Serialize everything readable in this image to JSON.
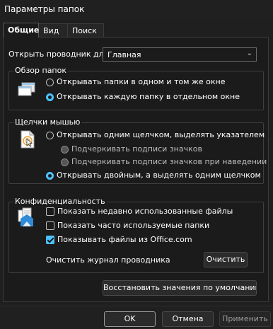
{
  "window": {
    "title": "Параметры папок"
  },
  "tabs": [
    {
      "label": "Общие",
      "active": true
    },
    {
      "label": "Вид",
      "active": false
    },
    {
      "label": "Поиск",
      "active": false
    }
  ],
  "open_explorer": {
    "label": "Открыть проводник для:",
    "value": "Главная"
  },
  "browse": {
    "title": "Обзор папок",
    "options": [
      {
        "label": "Открывать папки в одном и том же окне",
        "selected": false
      },
      {
        "label": "Открывать каждую папку в отдельном окне",
        "selected": true
      }
    ]
  },
  "clicks": {
    "title": "Щелчки мышью",
    "single_click": {
      "label": "Открывать одним щелчком, выделять указателем",
      "selected": false
    },
    "underline_always": {
      "label": "Подчеркивать подписи значков",
      "selected": false
    },
    "underline_hover": {
      "label": "Подчеркивать подписи значков при наведении",
      "selected": false
    },
    "double_click": {
      "label": "Открывать двойным, а выделять одним щелчком",
      "selected": true
    }
  },
  "privacy": {
    "title": "Конфиденциальность",
    "recent_files": {
      "label": "Показать недавно использованные файлы",
      "checked": false
    },
    "frequent_folders": {
      "label": "Показать часто используемые папки",
      "checked": false
    },
    "office_files": {
      "label": "Показывать файлы из Office.com",
      "checked": true
    },
    "clear_label": "Очистить журнал проводника",
    "clear_button": "Очистить"
  },
  "restore_defaults_button": "Восстановить значения по умолчанию",
  "footer": {
    "ok": "OK",
    "cancel": "Отмена",
    "apply": "Применить"
  },
  "colors": {
    "accent": "#4cc2ff",
    "background": "#1b1b1b"
  }
}
